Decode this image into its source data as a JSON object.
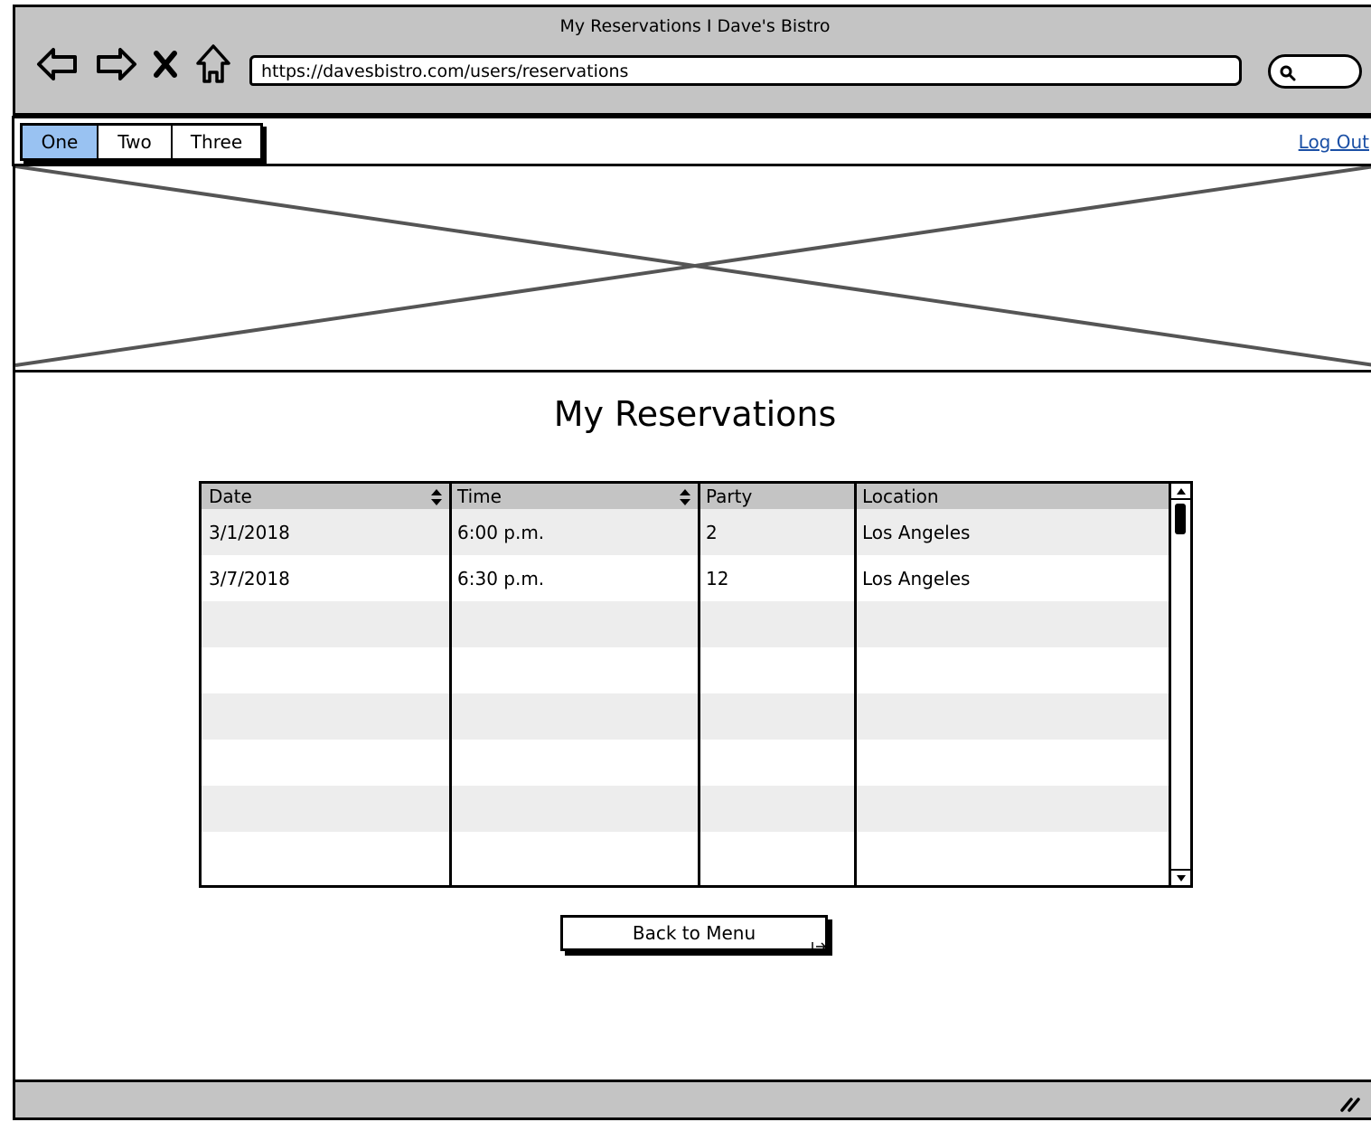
{
  "browser": {
    "window_title": "My Reservations I Dave's Bistro",
    "url": "https://davesbistro.com/users/reservations",
    "icons": [
      "back-arrow-icon",
      "forward-arrow-icon",
      "close-x-icon",
      "home-icon",
      "search-icon"
    ]
  },
  "nav": {
    "tabs": [
      {
        "label": "One",
        "active": true
      },
      {
        "label": "Two",
        "active": false
      },
      {
        "label": "Three",
        "active": false
      }
    ],
    "logout_label": "Log Out"
  },
  "main": {
    "title": "My Reservations",
    "table": {
      "columns": [
        "Date",
        "Time",
        "Party",
        "Location"
      ],
      "rows": [
        [
          "3/1/2018",
          "6:00 p.m.",
          "2",
          "Los Angeles"
        ],
        [
          "3/7/2018",
          "6:30 p.m.",
          "12",
          "Los Angeles"
        ],
        [
          "",
          "",
          "",
          ""
        ],
        [
          "",
          "",
          "",
          ""
        ],
        [
          "",
          "",
          "",
          ""
        ],
        [
          "",
          "",
          "",
          ""
        ],
        [
          "",
          "",
          "",
          ""
        ],
        [
          "",
          "",
          "",
          ""
        ]
      ]
    },
    "back_button_label": "Back to Menu"
  },
  "colors": {
    "chrome": "#c4c4c4",
    "active_tab": "#99c2f2",
    "link": "#1a4fa5",
    "row_alt": "#ededed"
  }
}
